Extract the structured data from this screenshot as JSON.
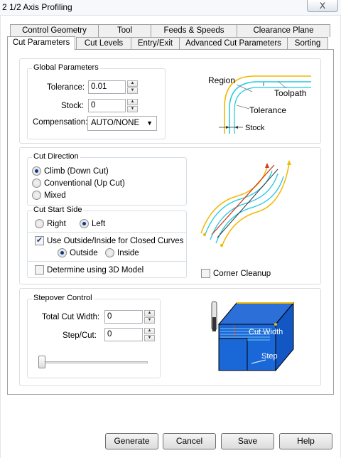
{
  "window": {
    "title": "2 1/2 Axis Profiling",
    "close_label": "X"
  },
  "tabs_back": [
    {
      "label": "Control Geometry"
    },
    {
      "label": "Tool"
    },
    {
      "label": "Feeds & Speeds"
    },
    {
      "label": "Clearance Plane"
    }
  ],
  "tabs_front": [
    {
      "label": "Cut Parameters",
      "active": true
    },
    {
      "label": "Cut Levels"
    },
    {
      "label": "Entry/Exit"
    },
    {
      "label": "Advanced Cut Parameters"
    },
    {
      "label": "Sorting"
    }
  ],
  "global_params": {
    "title": "Global Parameters",
    "tolerance_label": "Tolerance:",
    "tolerance_value": "0.01",
    "stock_label": "Stock:",
    "stock_value": "0",
    "compensation_label": "Compensation:",
    "compensation_value": "AUTO/NONE",
    "diagram": {
      "region": "Region",
      "toolpath": "Toolpath",
      "tolerance": "Tolerance",
      "stock": "Stock"
    }
  },
  "cut_direction": {
    "title": "Cut Direction",
    "options": [
      {
        "label": "Climb (Down Cut)",
        "selected": true
      },
      {
        "label": "Conventional (Up Cut)",
        "selected": false
      },
      {
        "label": "Mixed",
        "selected": false
      }
    ]
  },
  "cut_start_side": {
    "title": "Cut Start Side",
    "right_label": "Right",
    "left_label": "Left",
    "selected": "Left",
    "use_outside_inside_label": "Use Outside/Inside for Closed Curves",
    "use_outside_inside_checked": true,
    "outside_label": "Outside",
    "inside_label": "Inside",
    "selected_side": "Outside",
    "determine_3d_label": "Determine using 3D Model",
    "determine_3d_checked": false
  },
  "corner_cleanup": {
    "label": "Corner Cleanup",
    "checked": false
  },
  "stepover": {
    "title": "Stepover Control",
    "total_cut_width_label": "Total Cut Width:",
    "total_cut_width_value": "0",
    "step_cut_label": "Step/Cut:",
    "step_cut_value": "0",
    "slider_level": 0,
    "diagram": {
      "cut_width": "Cut Width",
      "step": "Step"
    }
  },
  "buttons": {
    "generate": "Generate",
    "cancel": "Cancel",
    "save": "Save",
    "help": "Help"
  },
  "colors": {
    "toolpath_yellow": "#f2b800",
    "region_cyan": "#21c9e0",
    "block_blue": "#1a68d8",
    "accent_red": "#d23a1f"
  }
}
